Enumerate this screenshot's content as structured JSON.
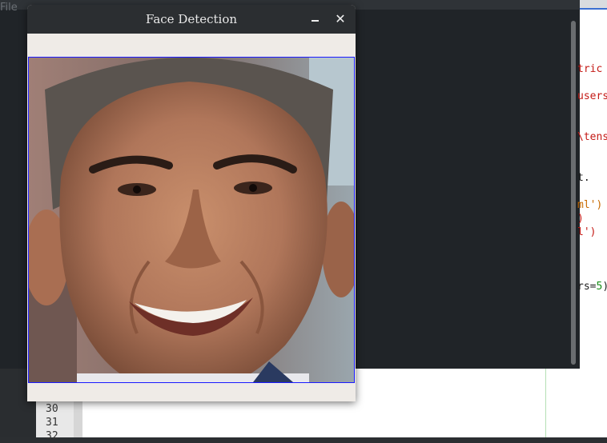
{
  "background_editor": {
    "menu_file": "File",
    "code_fragments": [
      "tric",
      "users",
      "\\tens",
      "t.",
      "ml')",
      ")",
      "l')",
      "rs=",
      "5",
      ")"
    ],
    "line_numbers": [
      "30",
      "31",
      "32"
    ]
  },
  "face_window": {
    "title": "Face Detection",
    "minimize_label": "_",
    "close_label": "✕",
    "image_description": "Detected face region (blue bounding box)"
  }
}
